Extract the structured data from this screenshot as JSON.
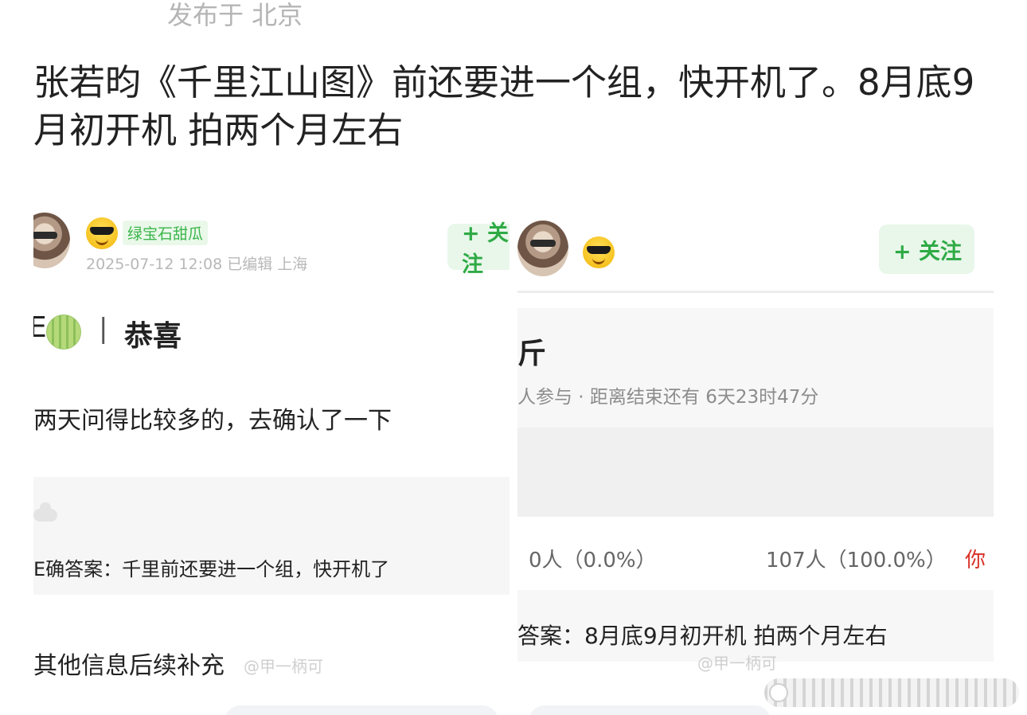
{
  "post": {
    "location": "发布于 北京",
    "text": "张若昀《千里江山图》前还要进一个组，快开机了。8月底9月初开机 拍两个月左右"
  },
  "left_image": {
    "badge": "绿宝石甜瓜",
    "meta": "2025-07-12 12:08  已编辑  上海",
    "follow": "+ 关注",
    "title_prefix": "E",
    "title_sep": "|",
    "title": "恭喜",
    "line1": "两天问得比较多的，去确认了一下",
    "answer": "E确答案：千里前还要进一个组，快开机了",
    "line3": "其他信息后续补充",
    "watermark": "@甲一柄可"
  },
  "right_image": {
    "follow": "+ 关注",
    "heading_fragment": "斤",
    "participation": "人参与 · 距离结束还有 6天23时47分",
    "option_a": "0人（0.0%）",
    "option_b": "107人（100.0%）",
    "option_b_suffix": "你",
    "answer": "答案：8月底9月初开机 拍两个月左右",
    "watermark": "@甲一柄可"
  },
  "colors": {
    "accent_green": "#2faa45",
    "badge_green": "#3bb54a",
    "red": "#d93025"
  }
}
